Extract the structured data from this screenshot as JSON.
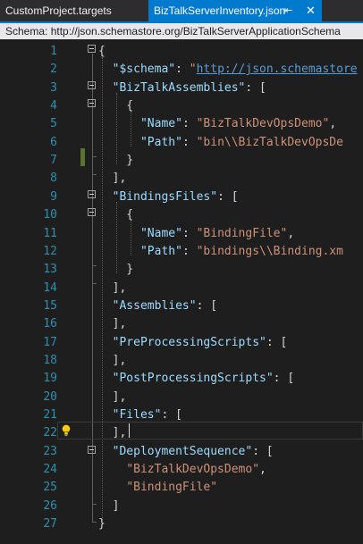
{
  "tabs": [
    {
      "label": "CustomProject.targets",
      "active": false
    },
    {
      "label": "BizTalkServerInventory.json",
      "active": true
    }
  ],
  "schema_bar": {
    "text": "Schema:  http://json.schemastore.org/BizTalkServerApplicationSchema"
  },
  "colors": {
    "accent": "#007acc",
    "background": "#1e1e1e",
    "line_numbers": "#2b91af",
    "keys": "#9cdcfe",
    "strings": "#ce9178",
    "link": "#569cd6"
  },
  "icons": {
    "pin": "pin-icon",
    "close": "close-icon",
    "lightbulb": "lightbulb-icon",
    "fold": "collapse-icon"
  },
  "lines": [
    {
      "n": "1",
      "tokens": [
        [
          "p",
          "{"
        ]
      ]
    },
    {
      "n": "2",
      "tokens": [
        [
          "p",
          "  "
        ],
        [
          "k",
          "\"$schema\""
        ],
        [
          "p",
          ": "
        ],
        [
          "s",
          "\""
        ],
        [
          "u",
          "http://json.schemastore"
        ]
      ]
    },
    {
      "n": "3",
      "tokens": [
        [
          "p",
          "  "
        ],
        [
          "k",
          "\"BizTalkAssemblies\""
        ],
        [
          "p",
          ": ["
        ]
      ]
    },
    {
      "n": "4",
      "tokens": [
        [
          "p",
          "    {"
        ]
      ]
    },
    {
      "n": "5",
      "tokens": [
        [
          "p",
          "      "
        ],
        [
          "k",
          "\"Name\""
        ],
        [
          "p",
          ": "
        ],
        [
          "s",
          "\"BizTalkDevOpsDemo\""
        ],
        [
          "p",
          ","
        ]
      ]
    },
    {
      "n": "6",
      "tokens": [
        [
          "p",
          "      "
        ],
        [
          "k",
          "\"Path\""
        ],
        [
          "p",
          ": "
        ],
        [
          "s",
          "\"bin\\\\BizTalkDevOpsDe"
        ]
      ]
    },
    {
      "n": "7",
      "tokens": [
        [
          "p",
          "    }"
        ]
      ]
    },
    {
      "n": "8",
      "tokens": [
        [
          "p",
          "  ],"
        ]
      ]
    },
    {
      "n": "9",
      "tokens": [
        [
          "p",
          "  "
        ],
        [
          "k",
          "\"BindingsFiles\""
        ],
        [
          "p",
          ": ["
        ]
      ]
    },
    {
      "n": "10",
      "tokens": [
        [
          "p",
          "    {"
        ]
      ]
    },
    {
      "n": "11",
      "tokens": [
        [
          "p",
          "      "
        ],
        [
          "k",
          "\"Name\""
        ],
        [
          "p",
          ": "
        ],
        [
          "s",
          "\"BindingFile\""
        ],
        [
          "p",
          ","
        ]
      ]
    },
    {
      "n": "12",
      "tokens": [
        [
          "p",
          "      "
        ],
        [
          "k",
          "\"Path\""
        ],
        [
          "p",
          ": "
        ],
        [
          "s",
          "\"bindings\\\\Binding.xm"
        ]
      ]
    },
    {
      "n": "13",
      "tokens": [
        [
          "p",
          "    }"
        ]
      ]
    },
    {
      "n": "14",
      "tokens": [
        [
          "p",
          "  ],"
        ]
      ]
    },
    {
      "n": "15",
      "tokens": [
        [
          "p",
          "  "
        ],
        [
          "k",
          "\"Assemblies\""
        ],
        [
          "p",
          ": ["
        ]
      ]
    },
    {
      "n": "16",
      "tokens": [
        [
          "p",
          "  ],"
        ]
      ]
    },
    {
      "n": "17",
      "tokens": [
        [
          "p",
          "  "
        ],
        [
          "k",
          "\"PreProcessingScripts\""
        ],
        [
          "p",
          ": ["
        ]
      ]
    },
    {
      "n": "18",
      "tokens": [
        [
          "p",
          "  ],"
        ]
      ]
    },
    {
      "n": "19",
      "tokens": [
        [
          "p",
          "  "
        ],
        [
          "k",
          "\"PostProcessingScripts\""
        ],
        [
          "p",
          ": ["
        ]
      ]
    },
    {
      "n": "20",
      "tokens": [
        [
          "p",
          "  ],"
        ]
      ]
    },
    {
      "n": "21",
      "tokens": [
        [
          "p",
          "  "
        ],
        [
          "k",
          "\"Files\""
        ],
        [
          "p",
          ": ["
        ]
      ]
    },
    {
      "n": "22",
      "tokens": [
        [
          "p",
          "  ],"
        ]
      ]
    },
    {
      "n": "23",
      "tokens": [
        [
          "p",
          "  "
        ],
        [
          "k",
          "\"DeploymentSequence\""
        ],
        [
          "p",
          ": ["
        ]
      ]
    },
    {
      "n": "24",
      "tokens": [
        [
          "p",
          "    "
        ],
        [
          "s",
          "\"BizTalkDevOpsDemo\""
        ],
        [
          "p",
          ","
        ]
      ]
    },
    {
      "n": "25",
      "tokens": [
        [
          "p",
          "    "
        ],
        [
          "s",
          "\"BindingFile\""
        ]
      ]
    },
    {
      "n": "26",
      "tokens": [
        [
          "p",
          "  ]"
        ]
      ]
    },
    {
      "n": "27",
      "tokens": [
        [
          "p",
          "}"
        ]
      ]
    }
  ]
}
